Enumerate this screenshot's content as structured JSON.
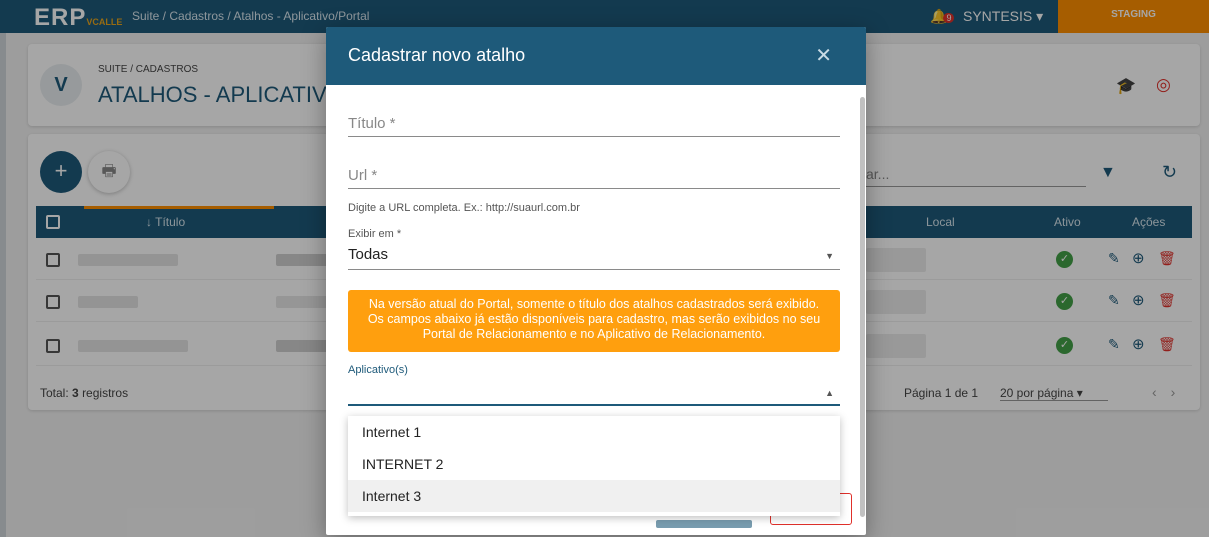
{
  "app": {
    "logo": "ERP",
    "logo_sub": "VCALLE",
    "breadcrumb": "Suite / Cadastros / Atalhos - Aplicativo/Portal",
    "notification_count": "9",
    "brand": "SYNTESIS",
    "env_badge": "STAGING"
  },
  "page": {
    "breadcrumb": "SUITE / CADASTROS",
    "title": "ATALHOS - APLICATIVO"
  },
  "list": {
    "search_placeholder": "ar...",
    "columns": [
      "Título",
      "Local",
      "Ativo",
      "Ações"
    ],
    "total_label": "Total:",
    "total_count": "3",
    "total_suffix": "registros",
    "page_label": "Página",
    "page_current": "1",
    "page_of": "de 1",
    "per_page": "20 por página"
  },
  "modal": {
    "title": "Cadastrar novo atalho",
    "close_glyph": "✕",
    "titulo_label": "Título *",
    "url_label": "Url *",
    "url_hint": "Digite a URL completa. Ex.: http://suaurl.com.br",
    "exibir_label": "Exibir em *",
    "exibir_value": "Todas",
    "warning_line1": "Na versão atual do Portal, somente o título dos atalhos cadastrados será exibido.",
    "warning_line2": "Os campos abaixo já estão disponíveis para cadastro, mas serão exibidos no seu",
    "warning_line3": "Portal de Relacionamento e no Aplicativo de Relacionamento.",
    "app_label": "Aplicativo(s)",
    "options": [
      "Internet 1",
      "INTERNET 2",
      "Internet 3"
    ],
    "highlighted_option": "Internet 3"
  },
  "colors": {
    "primary": "#1e5a7a",
    "accent": "#ff8f00",
    "warning": "#ff9f0e",
    "danger": "#e0302a",
    "success": "#43a047"
  }
}
